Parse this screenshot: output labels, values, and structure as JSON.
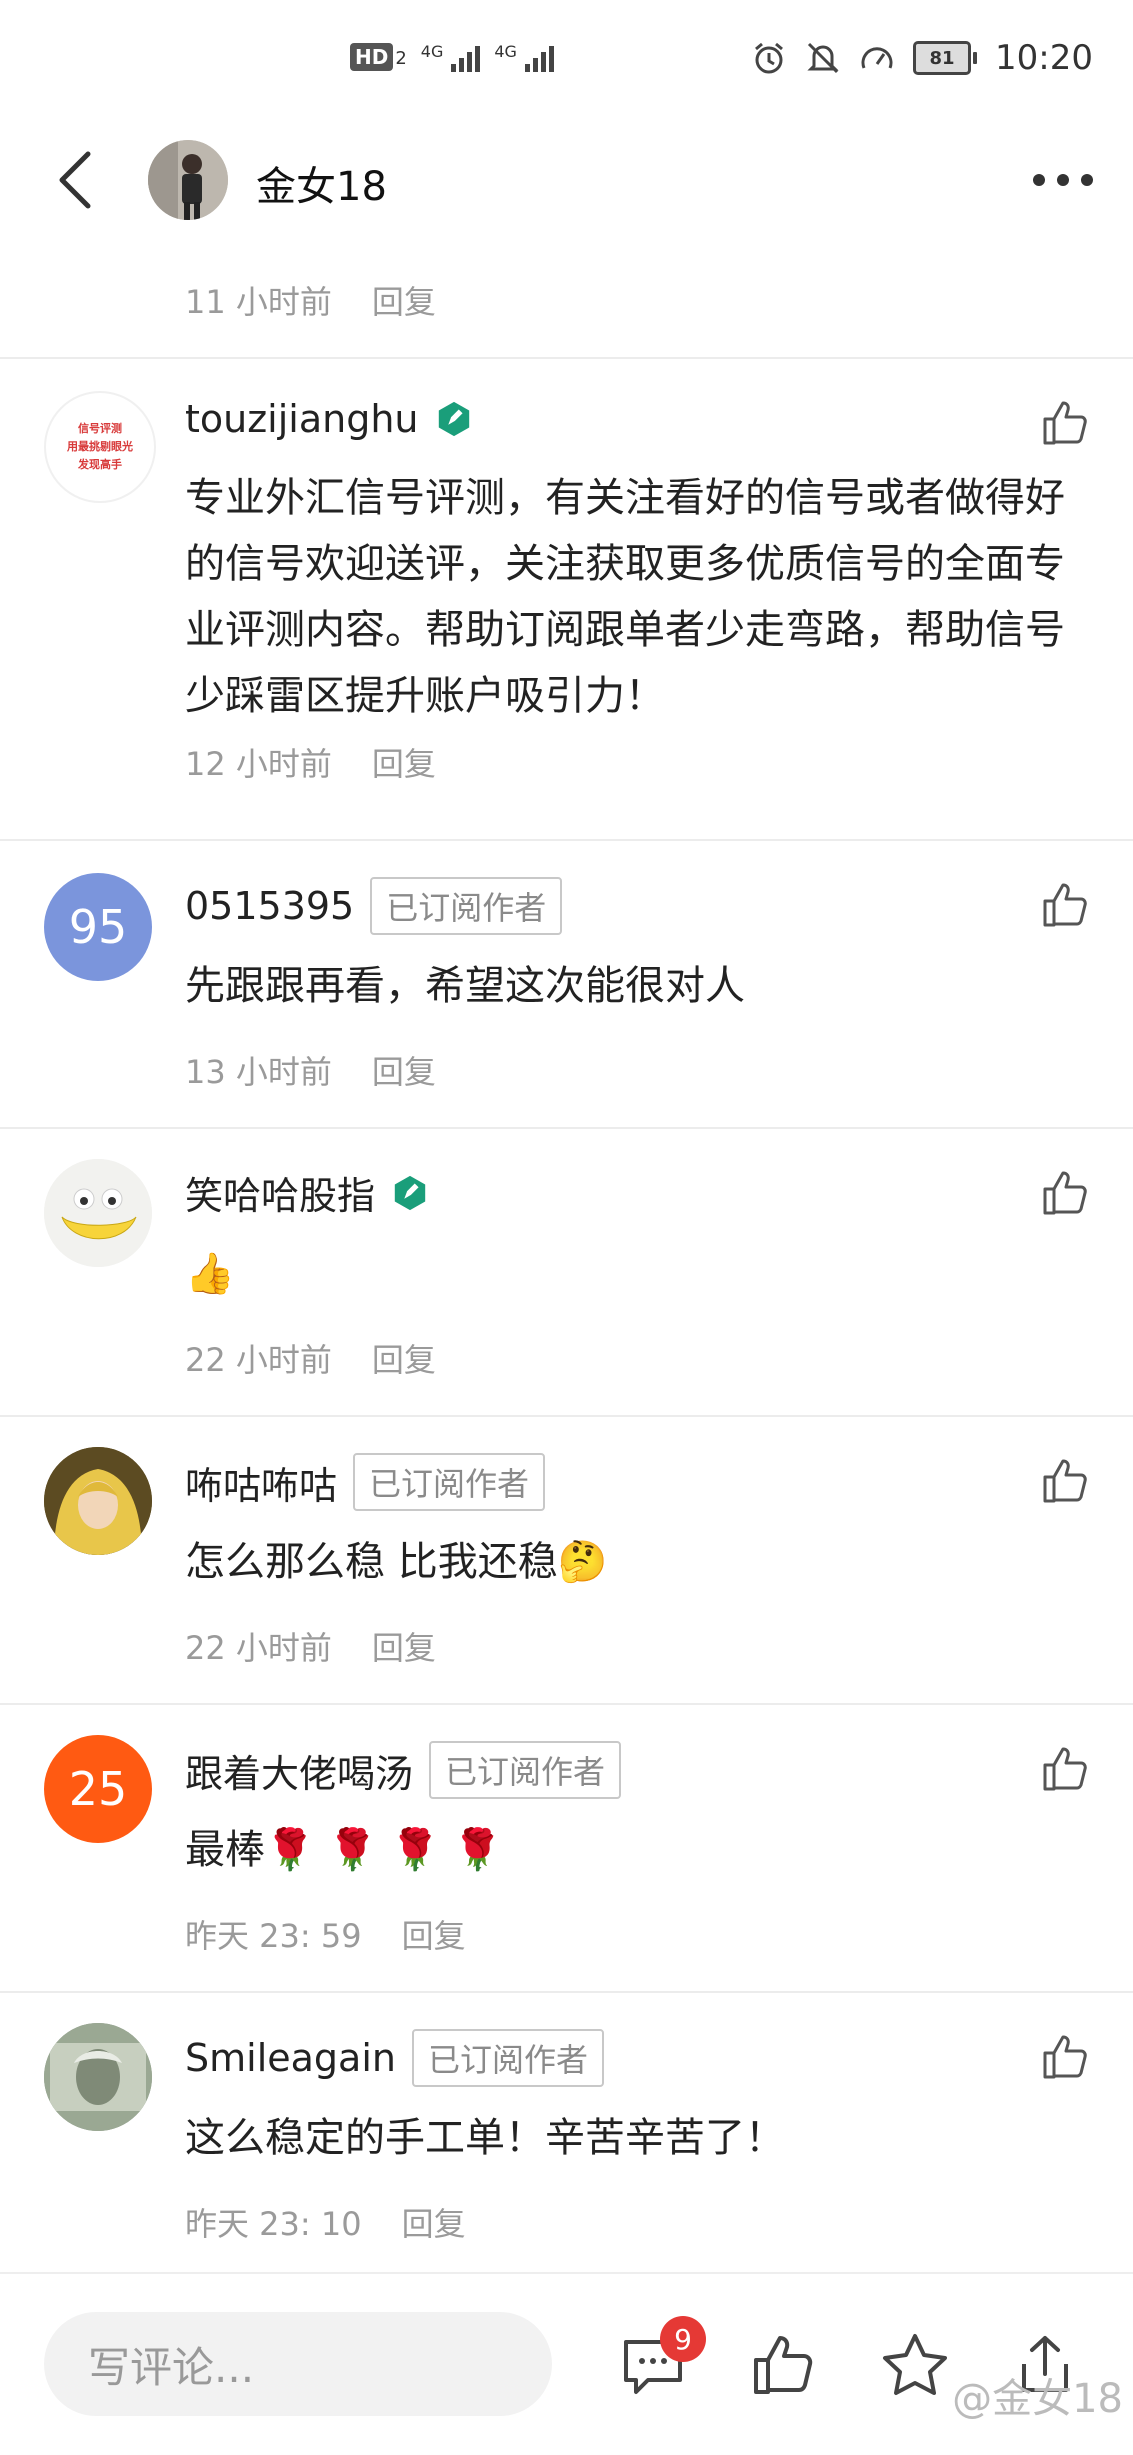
{
  "status_bar": {
    "hd": "HD",
    "hd_sub": "2",
    "net1": "4G",
    "net2": "4G",
    "battery": "81",
    "time": "10:20"
  },
  "header": {
    "title": "金女18"
  },
  "top_meta": {
    "time": "11 小时前",
    "reply": "回复"
  },
  "comments": [
    {
      "name": "touzijianghu",
      "verified": true,
      "subscriber_badge": "",
      "text": "专业外汇信号评测，有关注看好的信号或者做得好的信号欢迎送评，关注获取更多优质信号的全面专业评测内容。帮助订阅跟单者少走弯路，帮助信号少踩雷区提升账户吸引力！",
      "time": "12 小时前",
      "reply": "回复",
      "avatar_text": [
        "信号评测",
        "用最挑剔眼光",
        "发现高手"
      ]
    },
    {
      "name": "0515395",
      "verified": false,
      "subscriber_badge": "已订阅作者",
      "text": "先跟跟再看，希望这次能很对人",
      "time": "13 小时前",
      "reply": "回复",
      "avatar_text": "95"
    },
    {
      "name": "笑哈哈股指",
      "verified": true,
      "subscriber_badge": "",
      "text": "👍",
      "time": "22 小时前",
      "reply": "回复"
    },
    {
      "name": "咘咕咘咕",
      "verified": false,
      "subscriber_badge": "已订阅作者",
      "text": "怎么那么稳 比我还稳🤔",
      "time": "22 小时前",
      "reply": "回复"
    },
    {
      "name": "跟着大佬喝汤",
      "verified": false,
      "subscriber_badge": "已订阅作者",
      "text": "最棒🌹 🌹 🌹 🌹",
      "time": "昨天 23: 59",
      "reply": "回复",
      "avatar_text": "25"
    },
    {
      "name": "Smileagain",
      "verified": false,
      "subscriber_badge": "已订阅作者",
      "text": "这么稳定的手工单！辛苦辛苦了！",
      "time": "昨天 23: 10",
      "reply": "回复"
    }
  ],
  "bottom_bar": {
    "placeholder": "写评论...",
    "comment_count": "9",
    "watermark": "@金女18"
  },
  "colors": {
    "verified": "#1a9e7a",
    "avatar_95": "#7b95dc",
    "avatar_25": "#ff5a12",
    "badge_red": "#e53935"
  }
}
